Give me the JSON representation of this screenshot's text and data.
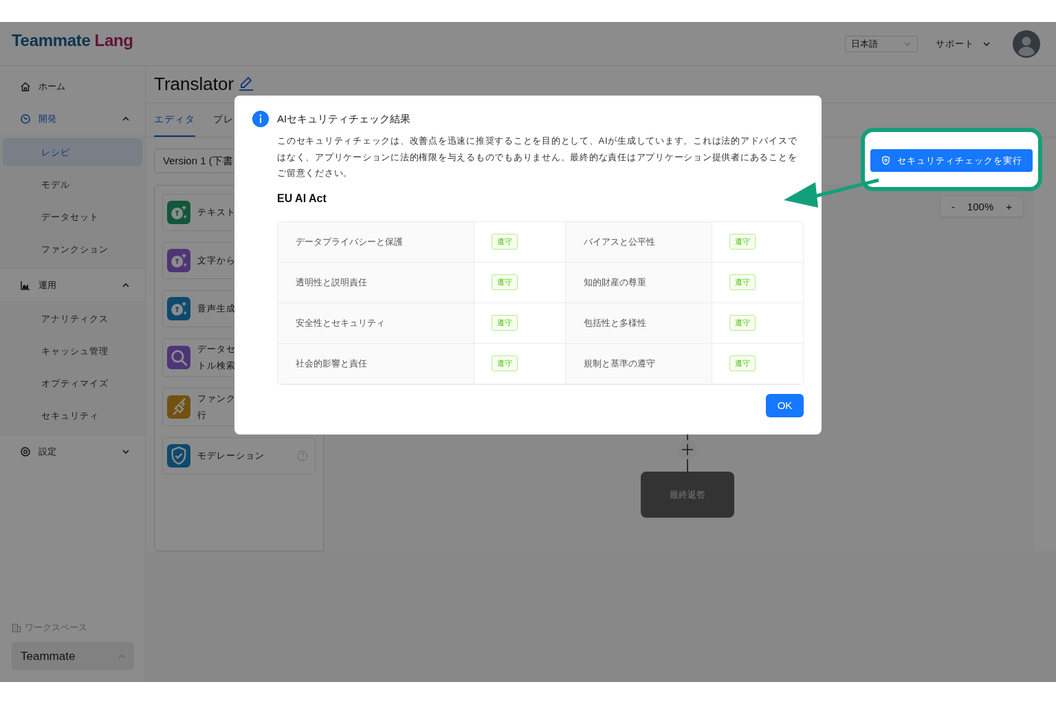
{
  "header": {
    "logo": {
      "primary": "Teammate",
      "secondary": "Lang"
    },
    "language": "日本語",
    "support": "サポート"
  },
  "sidebar": {
    "items": [
      {
        "label": "ホーム",
        "selected": false
      },
      {
        "label": "開発",
        "selected": true,
        "expanded": true,
        "children": [
          {
            "label": "レシピ",
            "selected": true
          },
          {
            "label": "モデル",
            "selected": false
          },
          {
            "label": "データセット",
            "selected": false
          },
          {
            "label": "ファンクション",
            "selected": false
          }
        ]
      },
      {
        "label": "運用",
        "selected": false,
        "expanded": true,
        "children": [
          {
            "label": "アナリティクス",
            "selected": false
          },
          {
            "label": "キャッシュ管理",
            "selected": false
          },
          {
            "label": "オプティマイズ",
            "selected": false
          },
          {
            "label": "セキュリティ",
            "selected": false
          }
        ]
      },
      {
        "label": "設定",
        "selected": false,
        "expanded": false
      }
    ],
    "workspace": {
      "label": "ワークスペース",
      "current": "Teammate"
    }
  },
  "main": {
    "title": "Translator",
    "tabs": [
      {
        "label": "エディタ",
        "selected": true
      },
      {
        "label": "プレ",
        "selected": false
      }
    ],
    "version": "Version 1 (下書",
    "palette": [
      {
        "lines": [
          "テキスト"
        ]
      },
      {
        "lines": [
          "文字から"
        ]
      },
      {
        "lines": [
          "音声生成"
        ]
      },
      {
        "lines": [
          "データセ",
          "トル検索"
        ]
      },
      {
        "lines": [
          "ファンク",
          "行"
        ]
      },
      {
        "lines": [
          "モデレーション"
        ],
        "help": true
      }
    ],
    "zoom": {
      "minus": "-",
      "value": "100%",
      "plus": "+"
    },
    "flow": {
      "node": "最終返答"
    }
  },
  "modal": {
    "title": "AIセキュリティチェック結果",
    "message": "このセキュリティチェックは、改善点を迅速に推奨することを目的として、AIが生成しています。これは法的アドバイスではなく、アプリケーションに法的権限を与えるものでもありません。最終的な責任はアプリケーション提供者にあることをご留意ください。",
    "section": "EU AI Act",
    "checks": [
      {
        "name": "データプライバシーと保護",
        "status": "遵守"
      },
      {
        "name": "バイアスと公平性",
        "status": "遵守"
      },
      {
        "name": "透明性と説明責任",
        "status": "遵守"
      },
      {
        "name": "知的財産の尊重",
        "status": "遵守"
      },
      {
        "name": "安全性とセキュリティ",
        "status": "遵守"
      },
      {
        "name": "包括性と多様性",
        "status": "遵守"
      },
      {
        "name": "社会的影響と責任",
        "status": "遵守"
      },
      {
        "name": "規制と基準の遵守",
        "status": "遵守"
      }
    ],
    "ok": "OK"
  },
  "spotlight": {
    "button": "セキュリティチェックを実行"
  }
}
